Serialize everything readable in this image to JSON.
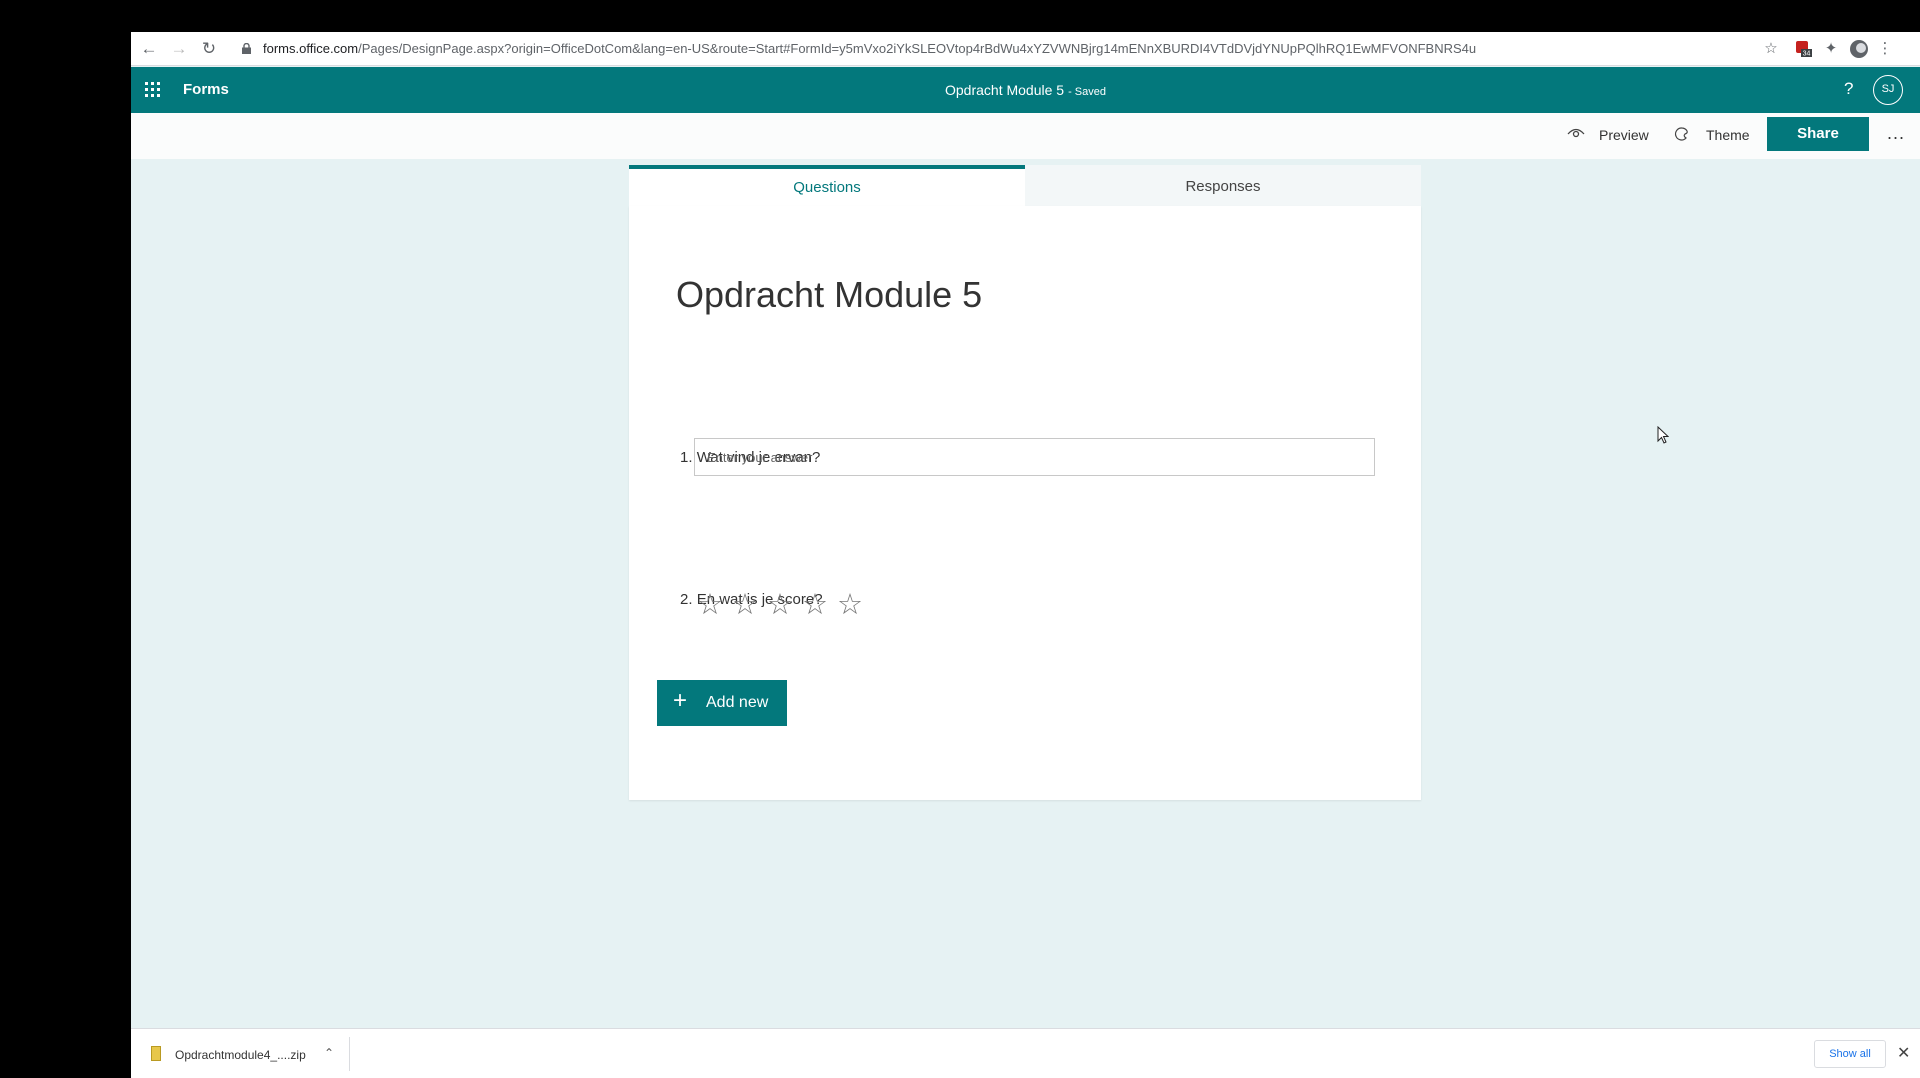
{
  "browser": {
    "url_host": "forms.office.com",
    "url_path": "/Pages/DesignPage.aspx?origin=OfficeDotCom&lang=en-US&route=Start#FormId=y5mVxo2iYkSLEOVtop4rBdWu4xYZVWNBjrg14mENnXBURDI4VTdDVjdYNUpPQlhRQ1EwMFVONFBNRS4u",
    "ext_badge": "34"
  },
  "appbar": {
    "app_name": "Forms",
    "doc_title": "Opdracht Module 5",
    "save_status": "- Saved",
    "help": "?",
    "avatar_initials": "SJ"
  },
  "cmdbar": {
    "preview_label": "Preview",
    "theme_label": "Theme",
    "share_label": "Share",
    "more_label": "..."
  },
  "tabs": [
    {
      "label": "Questions",
      "active": true
    },
    {
      "label": "Responses",
      "active": false
    }
  ],
  "form": {
    "title": "Opdracht Module 5",
    "questions": [
      {
        "number": "1.",
        "text": "Wat vind je ervan?",
        "placeholder": "Enter your answer"
      },
      {
        "number": "2.",
        "text": "En wat is je score?",
        "rating_max": 5,
        "rating_value": 0
      }
    ],
    "add_new_label": "Add new"
  },
  "download_bar": {
    "file_name": "Opdrachtmodule4_....zip",
    "show_all": "Show all"
  },
  "colors": {
    "brand": "#03787c",
    "page_bg": "#e6f2f3"
  }
}
